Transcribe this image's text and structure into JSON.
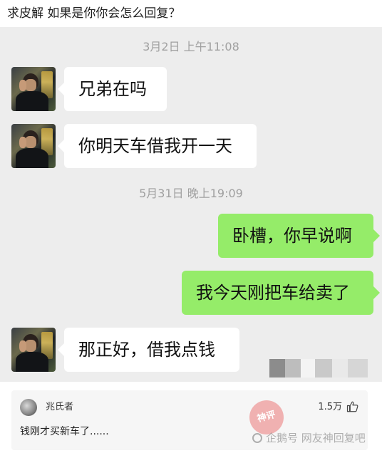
{
  "post": {
    "title": "求皮解 如果是你你会怎么回复？"
  },
  "chat": {
    "timestamps": [
      "3月2日 上午11:08",
      "5月31日 晚上19:09"
    ],
    "messages": [
      {
        "side": "left",
        "text": "兄弟在吗"
      },
      {
        "side": "left",
        "text": "你明天车借我开一天"
      },
      {
        "side": "right",
        "text": "卧槽，你早说啊"
      },
      {
        "side": "right",
        "text": "我今天刚把车给卖了"
      },
      {
        "side": "left",
        "text": "那正好，借我点钱"
      }
    ],
    "colors": {
      "background": "#ededed",
      "outgoing": "#95ec69",
      "incoming": "#ffffff"
    }
  },
  "comment": {
    "username": "兆氏者",
    "likes": "1.5万",
    "text": "钱刚才买新车了......",
    "icons": [
      "avatar",
      "thumb-up-icon"
    ]
  },
  "watermark": {
    "badge": "神评",
    "text": "企鹅号 网友神回复吧"
  }
}
